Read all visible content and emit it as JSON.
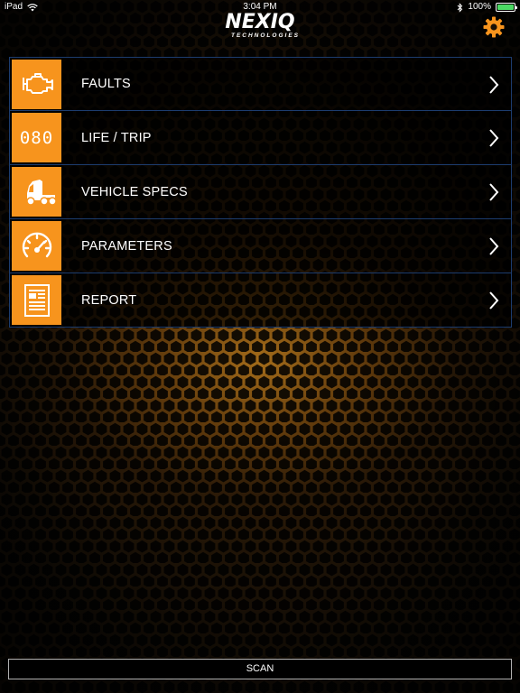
{
  "status_bar": {
    "device": "iPad",
    "time": "3:04 PM",
    "battery": "100%",
    "battery_level": 1.0
  },
  "header": {
    "logo_main": "NEXIQ",
    "logo_sub": "TECHNOLOGIES",
    "settings_icon": "gear-icon"
  },
  "menu": {
    "items": [
      {
        "label": "FAULTS",
        "icon": "engine-icon"
      },
      {
        "label": "LIFE / TRIP",
        "icon": "odometer-icon",
        "icon_text": "080"
      },
      {
        "label": "VEHICLE SPECS",
        "icon": "truck-icon"
      },
      {
        "label": "PARAMETERS",
        "icon": "speedometer-icon"
      },
      {
        "label": "REPORT",
        "icon": "report-icon"
      }
    ]
  },
  "footer": {
    "scan_label": "SCAN"
  },
  "colors": {
    "accent": "#f7941d",
    "item_border": "#1c3c6e",
    "battery_green": "#4cd964"
  }
}
